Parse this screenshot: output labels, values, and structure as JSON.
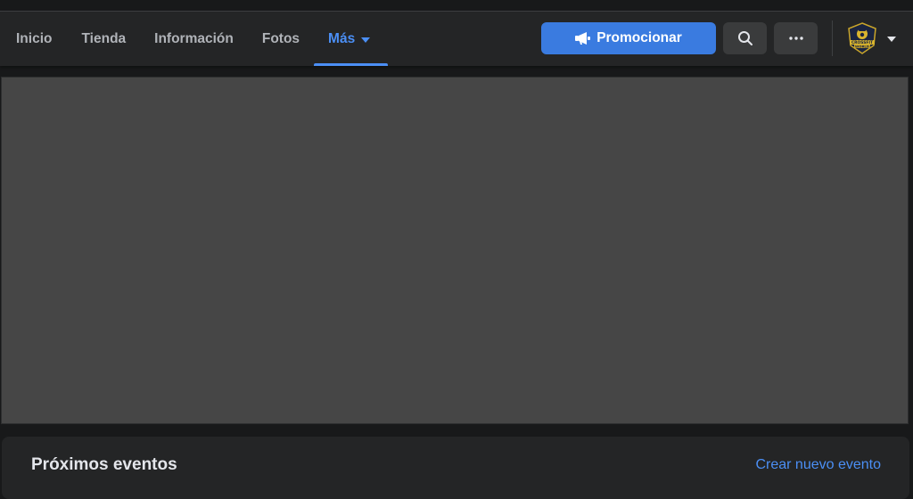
{
  "nav": {
    "tabs": [
      {
        "label": "Inicio"
      },
      {
        "label": "Tienda"
      },
      {
        "label": "Información"
      },
      {
        "label": "Fotos"
      },
      {
        "label": "Más",
        "active": true
      }
    ],
    "promote_label": "Promocionar",
    "search_icon": "search-icon",
    "more_icon": "more-icon",
    "avatar_text_line1": "CROSSFIT",
    "avatar_text_line2": "WORLD"
  },
  "events": {
    "title": "Próximos eventos",
    "create_link": "Crear nuevo evento"
  },
  "colors": {
    "accent": "#4b8ff5",
    "promote_bg": "#3a7be0",
    "navbar_bg": "#242526",
    "page_bg": "#18191a",
    "cover_bg": "#464646"
  }
}
